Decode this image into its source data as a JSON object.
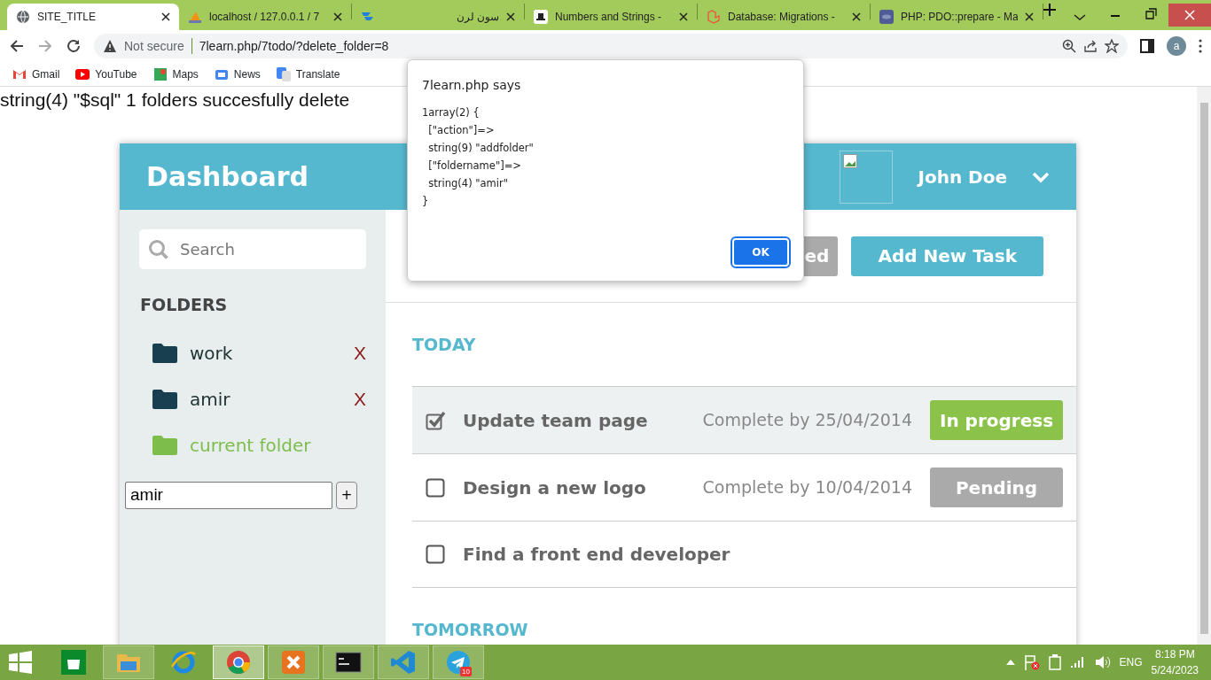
{
  "browser": {
    "tabs": [
      {
        "title": "SITE_TITLE",
        "selected": true
      },
      {
        "title": "localhost / 127.0.0.1 / 7",
        "selected": false
      },
      {
        "title": "سون لرن",
        "selected": false
      },
      {
        "title": "Numbers and Strings - ",
        "selected": false
      },
      {
        "title": "Database: Migrations - ",
        "selected": false
      },
      {
        "title": "PHP: PDO::prepare - Ma",
        "selected": false
      }
    ],
    "address": {
      "security": "Not secure",
      "url": "7learn.php/7todo/?delete_folder=8"
    },
    "profile_initial": "a",
    "bookmarks": [
      "Gmail",
      "YouTube",
      "Maps",
      "News",
      "Translate"
    ]
  },
  "page": {
    "debug_text": "string(4) \"$sql\" 1 folders succesfully delete"
  },
  "dashboard": {
    "title": "Dashboard",
    "user_name": "John Doe",
    "search": {
      "placeholder": "Search"
    },
    "folders_heading": "FOLDERS",
    "folders": [
      {
        "name": "work",
        "selected": false,
        "delete_label": "X"
      },
      {
        "name": "amir",
        "selected": false,
        "delete_label": "X"
      },
      {
        "name": "current folder",
        "selected": true
      }
    ],
    "new_folder": {
      "value": "amir",
      "add_label": "+"
    },
    "toolbar_buttons": [
      {
        "label": "ed",
        "kind": "secondary"
      },
      {
        "label": "Add New Task",
        "kind": "primary"
      }
    ],
    "sections": [
      {
        "title": "TODAY",
        "tasks": [
          {
            "title": "Update team page",
            "due": "Complete by 25/04/2014",
            "status": "In progress",
            "color": "#8bc34a",
            "checked": true
          },
          {
            "title": "Design a new logo",
            "due": "Complete by 10/04/2014",
            "status": "Pending",
            "color": "#aaaaaa",
            "checked": false
          },
          {
            "title": "Find a front end developer",
            "checked": false
          }
        ]
      },
      {
        "title": "TOMORROW"
      }
    ]
  },
  "dialog": {
    "title": "7learn.php says",
    "message": "1array(2) {\n  [\"action\"]=>\n  string(9) \"addfolder\"\n  [\"foldername\"]=>\n  string(4) \"amir\"\n}",
    "button": "OK"
  },
  "taskbar": {
    "apps": [
      {
        "kind": "store",
        "running": false,
        "selected": false
      },
      {
        "kind": "explorer",
        "running": true,
        "selected": false
      },
      {
        "kind": "ie",
        "running": false,
        "selected": false
      },
      {
        "kind": "chrome",
        "running": true,
        "selected": true
      },
      {
        "kind": "xampp",
        "running": true,
        "selected": false
      },
      {
        "kind": "terminal",
        "running": true,
        "selected": false
      },
      {
        "kind": "vscode",
        "running": true,
        "selected": false
      },
      {
        "kind": "telegram",
        "running": true,
        "selected": false,
        "badge": "10"
      }
    ],
    "tray": {
      "language": "ENG",
      "time": "8:18 PM",
      "date": "5/24/2023"
    }
  }
}
